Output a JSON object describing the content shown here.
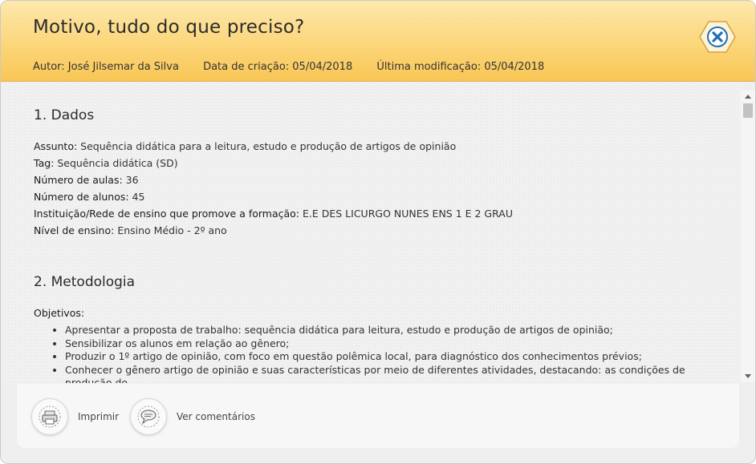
{
  "header": {
    "title": "Motivo, tudo do que preciso?",
    "author": "Autor: José Jilsemar da Silva",
    "created": "Data de criação: 05/04/2018",
    "modified": "Última modificação: 05/04/2018"
  },
  "close_icon": "close-icon",
  "section1": {
    "title": "1. Dados",
    "fields": [
      {
        "label": "Assunto:",
        "value": " Sequência didática para a leitura, estudo e produção de artigos de opinião"
      },
      {
        "label": "Tag:",
        "value": " Sequência didática (SD)"
      },
      {
        "label": "Número de aulas:",
        "value": " 36"
      },
      {
        "label": "Número de alunos:",
        "value": " 45"
      },
      {
        "label": "Instituição/Rede de ensino que promove a formação:",
        "value": " E.E DES LICURGO NUNES ENS 1 E 2 GRAU"
      },
      {
        "label": "Nível de ensino:",
        "value": " Ensino Médio - 2º ano"
      }
    ]
  },
  "section2": {
    "title": "2. Metodologia",
    "objectives_label": "Objetivos:",
    "objectives": [
      "Apresentar a proposta de trabalho: sequência didática para leitura, estudo e produção de artigos de opinião;",
      "Sensibilizar os alunos em relação ao gênero;",
      "Produzir o 1º artigo de opinião, com foco em questão polêmica local, para diagnóstico dos conhecimentos prévios;",
      "Conhecer o gênero artigo de opinião e suas características por meio de diferentes atividades, destacando: as condições de produção do"
    ]
  },
  "footer": {
    "print_label": "Imprimir",
    "comments_label": "Ver comentários",
    "print_icon": "printer-icon",
    "comments_icon": "speech-bubble-icon"
  },
  "colors": {
    "header_gradient_top": "#fde8ad",
    "header_gradient_bottom": "#f8c655",
    "close_blue": "#1f6fb5"
  }
}
